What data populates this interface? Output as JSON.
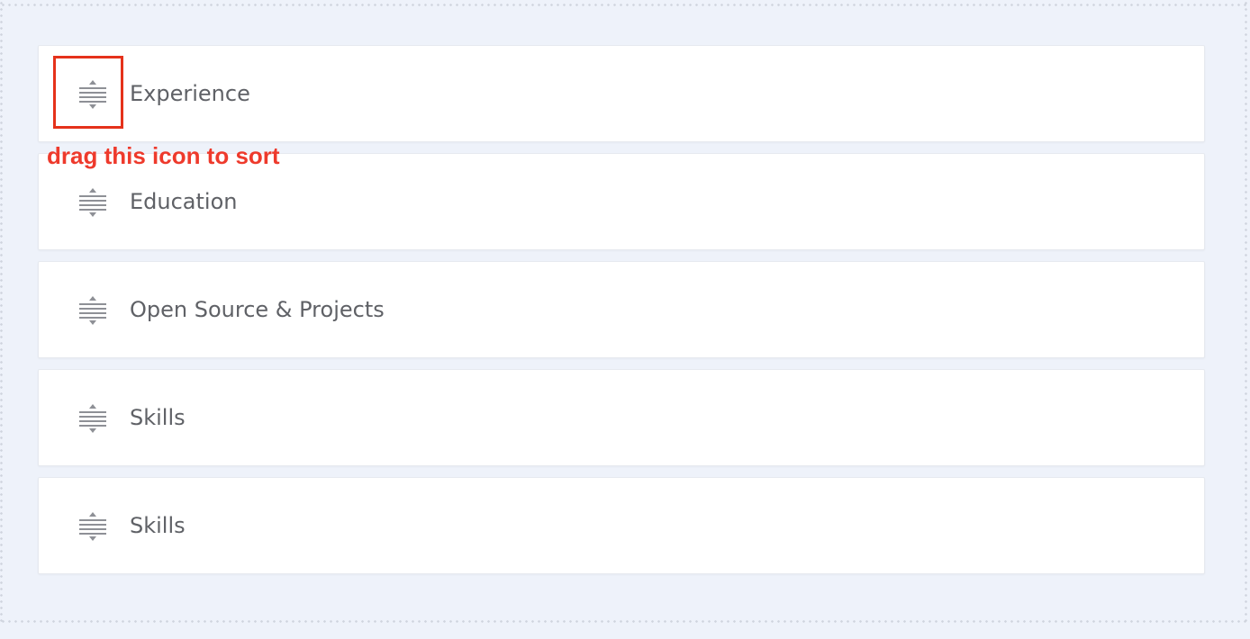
{
  "sections": [
    {
      "label": "Experience",
      "handle_icon": "drag-handle-icon"
    },
    {
      "label": "Education",
      "handle_icon": "drag-handle-icon"
    },
    {
      "label": "Open Source & Projects",
      "handle_icon": "drag-handle-icon"
    },
    {
      "label": "Skills",
      "handle_icon": "drag-handle-icon"
    },
    {
      "label": "Skills",
      "handle_icon": "drag-handle-icon"
    }
  ],
  "annotation": {
    "text": "drag this icon to sort",
    "color": "#ee3a2c",
    "box_color": "#e5321b"
  },
  "colors": {
    "background": "#eef2fa",
    "card": "#ffffff",
    "label_text": "#5f6166",
    "icon": "#8e9096"
  }
}
